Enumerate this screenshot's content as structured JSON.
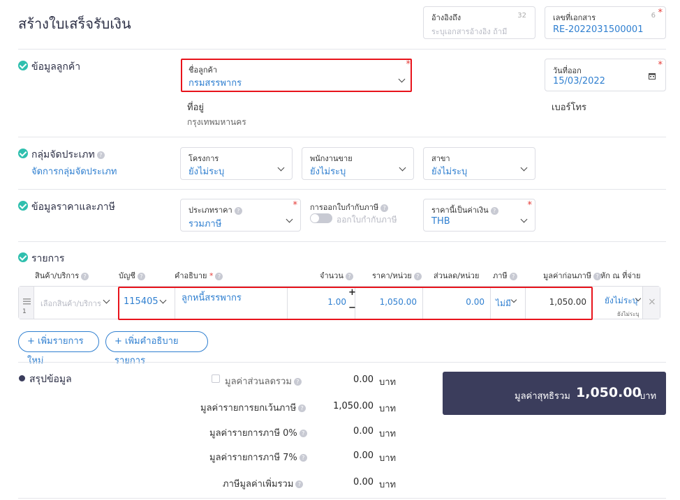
{
  "title": "สร้างใบเสร็จรับเงิน",
  "header": {
    "reference": {
      "label": "อ้างอิงถึง",
      "counter": "32",
      "placeholder": "ระบุเอกสารอ้างอิง ถ้ามี"
    },
    "doc_number": {
      "label": "เลขที่เอกสาร",
      "counter": "6",
      "value": "RE-2022031500001"
    }
  },
  "customer": {
    "section_title": "ข้อมูลลูกค้า",
    "name_label": "ชื่อลูกค้า",
    "name_value": "กรมสรรพากร",
    "address_label": "ที่อยู่",
    "address_value": "กรุงเทพมหานคร",
    "date_label": "วันที่ออก",
    "date_value": "15/03/2022",
    "phone_label": "เบอร์โทร"
  },
  "classification": {
    "section_title": "กลุ่มจัดประเภท",
    "manage_link": "จัดการกลุ่มจัดประเภท",
    "project_label": "โครงการ",
    "project_value": "ยังไม่ระบุ",
    "salesperson_label": "พนักงานขาย",
    "salesperson_value": "ยังไม่ระบุ",
    "branch_label": "สาขา",
    "branch_value": "ยังไม่ระบุ"
  },
  "pricing": {
    "section_title": "ข้อมูลราคาและภาษี",
    "price_type_label": "ประเภทราคา",
    "price_type_value": "รวมภาษี",
    "withholding_label": "การออกใบกำกับภาษี",
    "withholding_toggle_label": "ออกใบกำกับภาษี",
    "currency_label": "ราคานี้เป็นค่าเงิน",
    "currency_value": "THB"
  },
  "items": {
    "section_title": "รายการ",
    "columns": {
      "product": "สินค้า/บริการ",
      "account": "บัญชี",
      "description": "คำอธิบาย",
      "qty": "จำนวน",
      "unit_price": "ราคา/หน่วย",
      "discount": "ส่วนลด/หน่วย",
      "vat": "ภาษี",
      "pretax": "มูลค่าก่อนภาษี",
      "wht": "หัก ณ ที่จ่าย"
    },
    "row": {
      "index": "1",
      "product_placeholder": "เลือกสินค้า/บริการ",
      "account": "115405",
      "description": "ลูกหนี้สรรพากร",
      "qty": "1.00",
      "unit_price": "1,050.00",
      "discount": "0.00",
      "vat": "ไม่มี",
      "pretax": "1,050.00",
      "wht": "ยังไม่ระบุ",
      "wht_sub": "ยังไม่ระบุ"
    },
    "add_item_button": "เพิ่มรายการใหม่",
    "add_desc_button": "เพิ่มคำอธิบายรายการ"
  },
  "summary": {
    "section_title": "สรุปข้อมูล",
    "discount_label": "มูลค่าส่วนลดรวม",
    "discount_value": "0.00",
    "exempt_label": "มูลค่ารายการยกเว้นภาษี",
    "exempt_value": "1,050.00",
    "vat0_label": "มูลค่ารายการภาษี 0%",
    "vat0_value": "0.00",
    "vat7_label": "มูลค่ารายการภาษี 7%",
    "vat7_value": "0.00",
    "vat_total_label": "ภาษีมูลค่าเพิ่มรวม",
    "vat_total_value": "0.00",
    "currency": "บาท",
    "net_label": "มูลค่าสุทธิรวม",
    "net_value": "1,050.00",
    "net_currency": "บาท"
  },
  "colors": {
    "accent": "#2f7fd0",
    "highlight": "#e8131b",
    "check": "#2fbfae",
    "navy": "#3b3d5c"
  }
}
